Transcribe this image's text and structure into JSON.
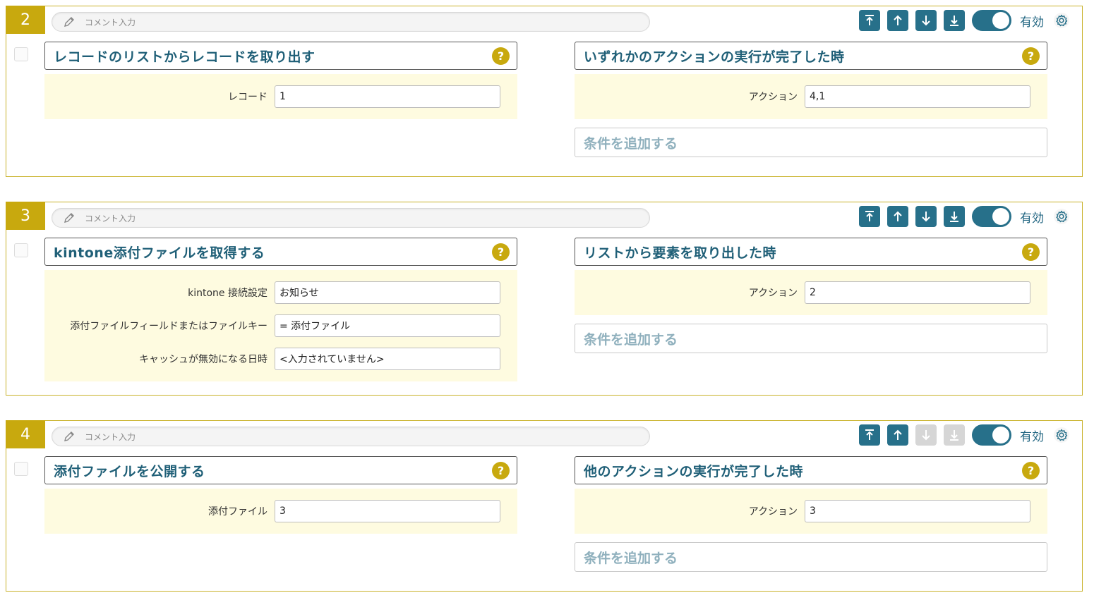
{
  "colors": {
    "accent": "#c8a90e",
    "primary": "#27708a",
    "panel_bg": "#fefbe0",
    "disabled": "#d6d6d6"
  },
  "cards": [
    {
      "number": "2",
      "comment_placeholder": "コメント入力",
      "enabled_label": "有効",
      "toggle_on": true,
      "move_down_disabled": false,
      "action": {
        "title": "レコードのリストからレコードを取り出す",
        "fields": [
          {
            "label": "レコード",
            "value": "1"
          }
        ]
      },
      "trigger": {
        "title": "いずれかのアクションの実行が完了した時",
        "fields": [
          {
            "label": "アクション",
            "value": "4,1"
          }
        ],
        "add_condition": "条件を追加する"
      }
    },
    {
      "number": "3",
      "comment_placeholder": "コメント入力",
      "enabled_label": "有効",
      "toggle_on": true,
      "move_down_disabled": false,
      "action": {
        "title": "kintone添付ファイルを取得する",
        "fields": [
          {
            "label": "kintone 接続設定",
            "value": "お知らせ"
          },
          {
            "label": "添付ファイルフィールドまたはファイルキー",
            "value": "= 添付ファイル"
          },
          {
            "label": "キャッシュが無効になる日時",
            "value": "<入力されていません>"
          }
        ]
      },
      "trigger": {
        "title": "リストから要素を取り出した時",
        "fields": [
          {
            "label": "アクション",
            "value": "2"
          }
        ],
        "add_condition": "条件を追加する"
      }
    },
    {
      "number": "4",
      "comment_placeholder": "コメント入力",
      "enabled_label": "有効",
      "toggle_on": true,
      "move_down_disabled": true,
      "action": {
        "title": "添付ファイルを公開する",
        "fields": [
          {
            "label": "添付ファイル",
            "value": "3"
          }
        ]
      },
      "trigger": {
        "title": "他のアクションの実行が完了した時",
        "fields": [
          {
            "label": "アクション",
            "value": "3"
          }
        ],
        "add_condition": "条件を追加する"
      }
    }
  ]
}
